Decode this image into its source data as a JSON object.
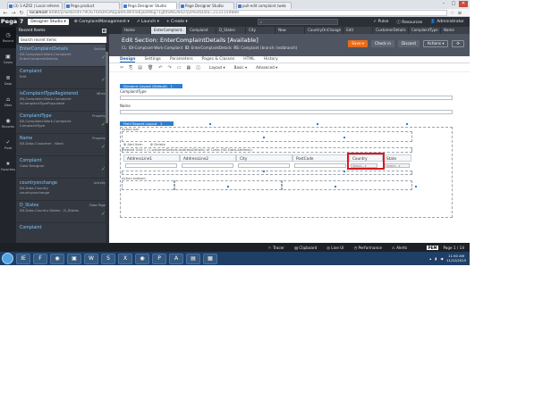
{
  "browser": {
    "tabs": [
      {
        "label": "(3) 1-AZ02 | Local referen"
      },
      {
        "label": "Pega product"
      },
      {
        "label": "Pega Designer Studio"
      },
      {
        "label": "Page Designer Studio"
      },
      {
        "label": "pull-edit complaint (web"
      }
    ],
    "url_host": "localhost",
    "url_rest": ":8080/prweb/sdV79OGT6RDROAbpa6fEWnhebyb4Wig71gf0SNGARD?pzPostData=2131159889"
  },
  "header": {
    "logo": "Pega",
    "version": "7",
    "studio": "Designer Studio",
    "items": [
      "ComplaintManagement",
      "Launch",
      "Create"
    ],
    "search_placeholder": "",
    "right_items": [
      "Pulse",
      "Resources",
      "Administrator"
    ]
  },
  "rail": [
    "Recent",
    "Cases",
    "Data",
    "Sites",
    "Records",
    "Pivot",
    "Favorites"
  ],
  "explorer": {
    "title": "Recent Items",
    "search_placeholder": "Search recent items",
    "items": [
      {
        "title": "EnterComplaintDetails",
        "sub": "IDI-Complaint-Work-Complaint\nEnterComplaintDetails",
        "tag": "Section",
        "check": "✓"
      },
      {
        "title": "Complaint",
        "sub": "Edit",
        "tag": "",
        "check": "✓"
      },
      {
        "title": "isComplaintTypeRegistered",
        "sub": "IDI-Complaint-Work-Complaint\nisComplaintTypePopulated",
        "tag": "When",
        "check": ""
      },
      {
        "title": "ComplaintType",
        "sub": "IDI-Complaint-Work-Complaint\nComplaintType",
        "tag": "Property",
        "check": "✓"
      },
      {
        "title": "Name",
        "sub": "IDI-Data-Customer - Work",
        "tag": "Property",
        "check": "✓"
      },
      {
        "title": "Complaint",
        "sub": "Case Designer",
        "tag": "",
        "check": "✓"
      },
      {
        "title": "countryonchange",
        "sub": "IDI-Data-Country\ncountryonchange",
        "tag": "Activity",
        "check": ""
      },
      {
        "title": "D_States",
        "sub": "IDI-Data-Country-States - D_States",
        "tag": "Data Page",
        "check": "✓"
      },
      {
        "title": "Complaint",
        "sub": "",
        "tag": "",
        "check": ""
      }
    ]
  },
  "doc_tabs": [
    "Home",
    "EnterComplaint..",
    "Complaint",
    "D_States",
    "City",
    "New",
    "CountryOnChange",
    "Edit",
    "CustomerDetails",
    "ComplaintType",
    "Name"
  ],
  "rule": {
    "title": "Edit Section: EnterComplaintDetails [Available]",
    "sub_prefix": "CL: IDI-Complaint-Work-Complaint",
    "sub_id_label": "ID:",
    "sub_id": "EnterComplaintDetails",
    "sub_rs_label": "RS:",
    "sub_rs": "Complaint (branch: testbranch)",
    "save": "Save",
    "checkin": "Check in",
    "discard": "Discard",
    "actions": "Actions"
  },
  "subtabs": [
    "Design",
    "Settings",
    "Parameters",
    "Pages & Classes",
    "HTML",
    "History"
  ],
  "toolbar": {
    "layout": "Layout",
    "basic": "Basic",
    "advanced": "Advanced"
  },
  "canvas": {
    "layout1": "Dynamic Layout (Default)",
    "layout1_num": "1",
    "field1": "ComplaintType",
    "field2": "Name",
    "layout2": "Field Repeat Layout",
    "layout2_num": "2",
    "action_bar": "Action bar",
    "add_item": "Add item",
    "delete": "Delete",
    "repeat_grid": "Repeat Grid 1 (.CustomerDetails.AddressDetails) of Class (IDI-Data-Address)",
    "columns": [
      "AddressLine1",
      "AddressLine2",
      "City",
      "PostCode",
      "Country",
      "State"
    ],
    "country_select": "Select...",
    "state_select": "Select...",
    "action_bottom": "Action bottom"
  },
  "status_bar": {
    "items": [
      "Tracer",
      "Clipboard",
      "Live UI",
      "Performance",
      "Alerts"
    ],
    "pega_badge": "PEM",
    "page": "Page 1 / 14"
  },
  "taskbar": {
    "apps": [
      "IE",
      "F",
      "◉",
      "▣",
      "W",
      "S",
      "X",
      "◉",
      "P",
      "A",
      "▤",
      "▦"
    ],
    "time": "11:50 AM",
    "date": "11/12/2015"
  },
  "colors": {
    "accent": "#2f7fd1",
    "save": "#ea6c1a",
    "highlight": "#d81b1b",
    "header": "#2b2f36"
  }
}
